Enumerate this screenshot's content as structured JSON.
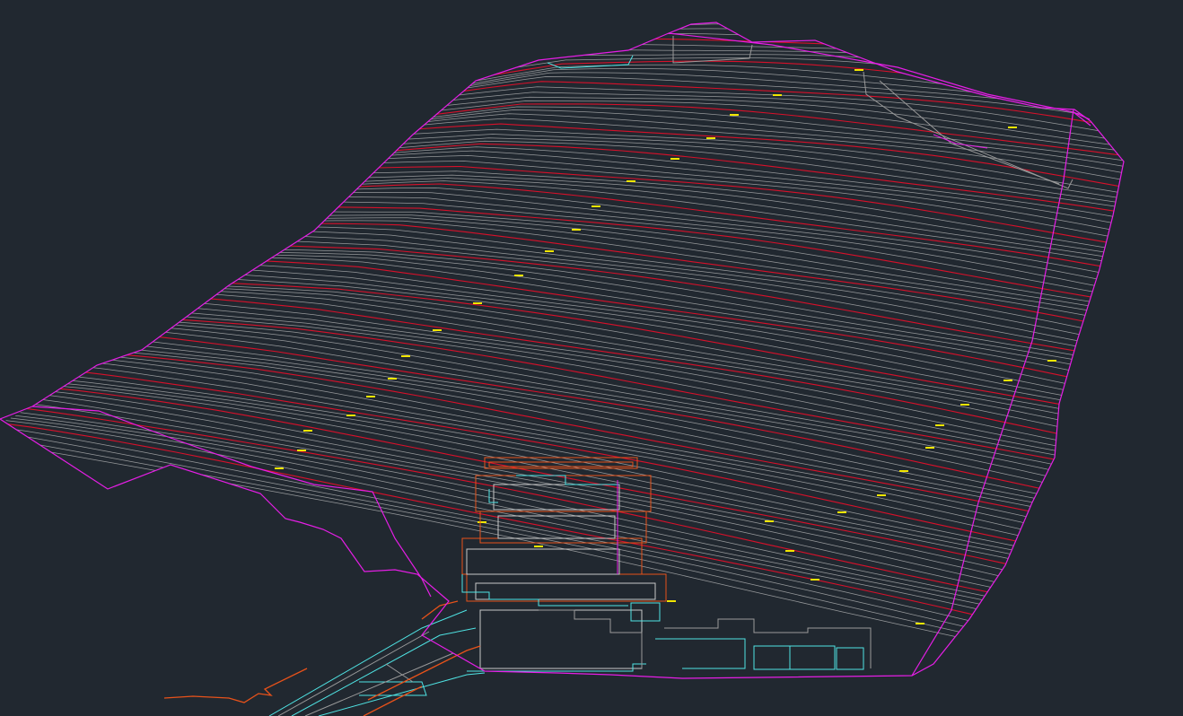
{
  "drawing": {
    "background": "#212830",
    "colors": {
      "boundary": "#e61ee6",
      "index_contour": "#e0102a",
      "minor_contour": "#c8c8c8",
      "structure_cyan": "#4fe3e3",
      "structure_orange": "#e8521a",
      "structure_grey": "#9a9a9a",
      "elevation_label": "#f2e600"
    },
    "layers": {
      "site_boundary": "site-boundary",
      "contours": "contour-lines",
      "buildings": "building-footprints",
      "road": "access-road"
    },
    "contour_interval_note": "",
    "elevation_labels": [
      "",
      "",
      "",
      "",
      "",
      "",
      "",
      "",
      "",
      "",
      "",
      "",
      "",
      "",
      "",
      "",
      "",
      "",
      "",
      "",
      "",
      "",
      "",
      "",
      "",
      "",
      "",
      "",
      "",
      "",
      ""
    ]
  }
}
